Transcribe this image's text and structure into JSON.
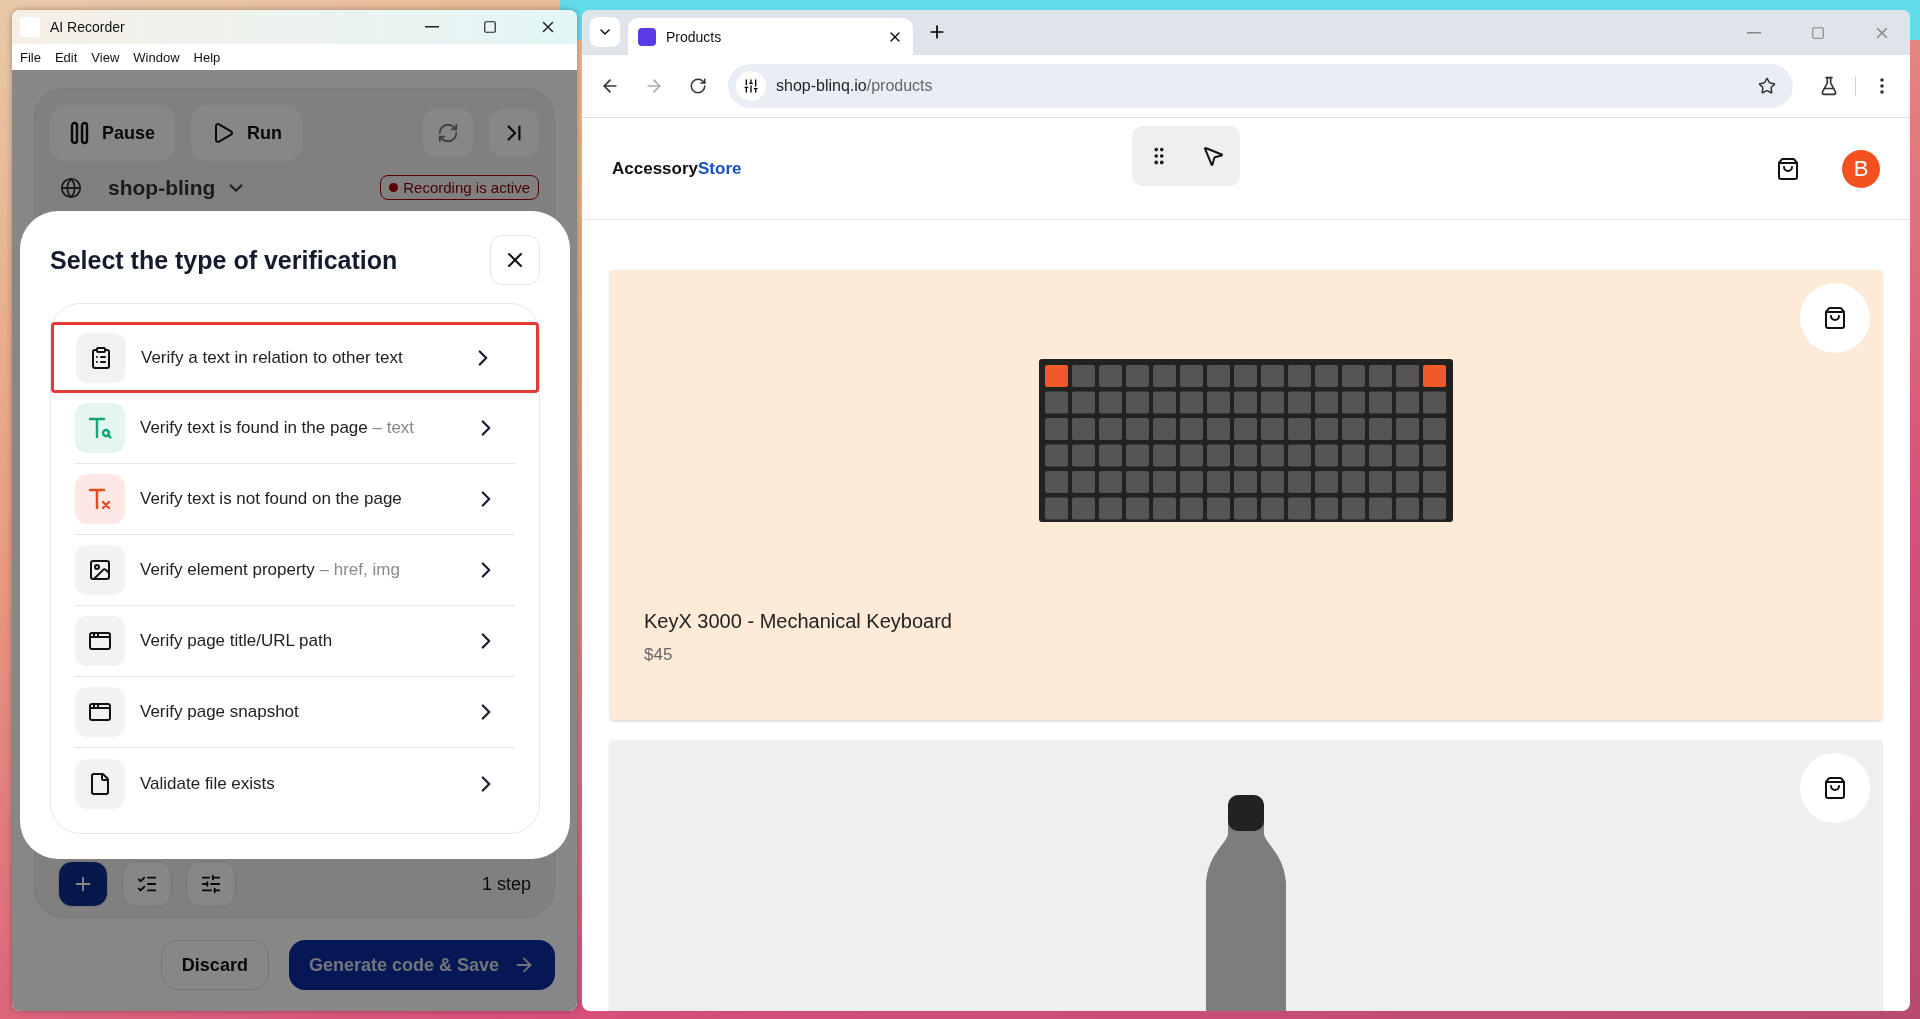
{
  "recorder": {
    "title": "AI Recorder",
    "menu": [
      "File",
      "Edit",
      "View",
      "Window",
      "Help"
    ],
    "pause": "Pause",
    "run": "Run",
    "site": "shop-bling",
    "recording_badge": "Recording is active",
    "step_count": "1 step",
    "discard": "Discard",
    "generate": "Generate code & Save"
  },
  "dialog": {
    "title": "Select the type of verification",
    "options": [
      {
        "kind": "relation",
        "label": "Verify a text in relation to other text",
        "selected": true
      },
      {
        "kind": "found",
        "label": "Verify text is found in the page",
        "hint": "– text",
        "selected": false
      },
      {
        "kind": "not-found",
        "label": "Verify text is not found on the page",
        "selected": false
      },
      {
        "kind": "property",
        "label": "Verify element property",
        "hint": "– href, img",
        "selected": false
      },
      {
        "kind": "title",
        "label": "Verify page title/URL path",
        "selected": false
      },
      {
        "kind": "snapshot",
        "label": "Verify page snapshot",
        "selected": false
      },
      {
        "kind": "file",
        "label": "Validate file exists",
        "selected": false
      }
    ]
  },
  "browser": {
    "tab": "Products",
    "url_host": "shop-blinq.io",
    "url_path": "/products",
    "logo": {
      "first": "Accessory",
      "second": "Store"
    },
    "avatar": "B",
    "products": [
      {
        "kind": "keyboard",
        "name": "KeyX 3000 - Mechanical Keyboard",
        "price": "$45",
        "color": "#fdebd8"
      },
      {
        "kind": "bottle",
        "color": "#efefef"
      }
    ]
  }
}
